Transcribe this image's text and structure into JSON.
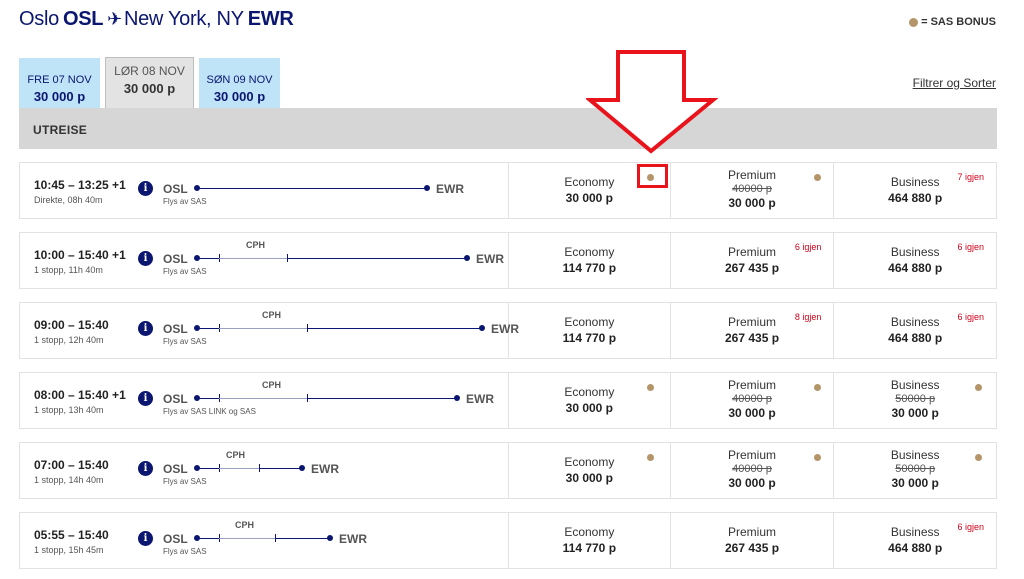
{
  "header": {
    "origin_city": "Oslo",
    "origin_code": "OSL",
    "plane_icon": "plane-icon",
    "dest_city": "New York, NY",
    "dest_code": "EWR",
    "bonus_legend": "= SAS BONUS",
    "bonus_color": "#b39569"
  },
  "tabs": [
    {
      "day": "FRE 07 NOV",
      "price": "30 000 p",
      "selected": false
    },
    {
      "day": "LØR 08 NOV",
      "price": "30 000 p",
      "selected": true
    },
    {
      "day": "SØN 09 NOV",
      "price": "30 000 p",
      "selected": false
    }
  ],
  "filter_link": "Filtrer og Sorter",
  "section_title": "UTREISE",
  "flights": [
    {
      "times": "10:45 – 13:25 +1",
      "stops": "Direkte, 08h 40m",
      "origin": "OSL",
      "dest": "EWR",
      "via": "",
      "operator": "Flys av SAS",
      "economy": {
        "label": "Economy",
        "old": "",
        "price": "30 000 p",
        "seats": "",
        "bonus": true
      },
      "premium": {
        "label": "Premium",
        "old": "40000 p",
        "price": "30 000 p",
        "seats": "",
        "bonus": true
      },
      "business": {
        "label": "Business",
        "old": "",
        "price": "464 880 p",
        "seats": "7 igjen",
        "bonus": false
      }
    },
    {
      "times": "10:00 – 15:40 +1",
      "stops": "1 stopp, 11h 40m",
      "origin": "OSL",
      "dest": "EWR",
      "via": "CPH",
      "operator": "Flys av SAS",
      "economy": {
        "label": "Economy",
        "old": "",
        "price": "114 770 p",
        "seats": "",
        "bonus": false
      },
      "premium": {
        "label": "Premium",
        "old": "",
        "price": "267 435 p",
        "seats": "6 igjen",
        "bonus": false
      },
      "business": {
        "label": "Business",
        "old": "",
        "price": "464 880 p",
        "seats": "6 igjen",
        "bonus": false
      }
    },
    {
      "times": "09:00 – 15:40",
      "stops": "1 stopp, 12h 40m",
      "origin": "OSL",
      "dest": "EWR",
      "via": "CPH",
      "operator": "Flys av SAS",
      "economy": {
        "label": "Economy",
        "old": "",
        "price": "114 770 p",
        "seats": "",
        "bonus": false
      },
      "premium": {
        "label": "Premium",
        "old": "",
        "price": "267 435 p",
        "seats": "8 igjen",
        "bonus": false
      },
      "business": {
        "label": "Business",
        "old": "",
        "price": "464 880 p",
        "seats": "6 igjen",
        "bonus": false
      }
    },
    {
      "times": "08:00 – 15:40 +1",
      "stops": "1 stopp, 13h 40m",
      "origin": "OSL",
      "dest": "EWR",
      "via": "CPH",
      "operator": "Flys av SAS LINK og SAS",
      "economy": {
        "label": "Economy",
        "old": "",
        "price": "30 000 p",
        "seats": "",
        "bonus": true
      },
      "premium": {
        "label": "Premium",
        "old": "40000 p",
        "price": "30 000 p",
        "seats": "",
        "bonus": true
      },
      "business": {
        "label": "Business",
        "old": "50000 p",
        "price": "30 000 p",
        "seats": "",
        "bonus": true
      }
    },
    {
      "times": "07:00 – 15:40",
      "stops": "1 stopp, 14h 40m",
      "origin": "OSL",
      "dest": "EWR",
      "via": "CPH",
      "operator": "Flys av SAS",
      "economy": {
        "label": "Economy",
        "old": "",
        "price": "30 000 p",
        "seats": "",
        "bonus": true
      },
      "premium": {
        "label": "Premium",
        "old": "40000 p",
        "price": "30 000 p",
        "seats": "",
        "bonus": true
      },
      "business": {
        "label": "Business",
        "old": "50000 p",
        "price": "30 000 p",
        "seats": "",
        "bonus": true
      }
    },
    {
      "times": "05:55 – 15:40",
      "stops": "1 stopp, 15h 45m",
      "origin": "OSL",
      "dest": "EWR",
      "via": "CPH",
      "operator": "Flys av SAS",
      "economy": {
        "label": "Economy",
        "old": "",
        "price": "114 770 p",
        "seats": "",
        "bonus": false
      },
      "premium": {
        "label": "Premium",
        "old": "",
        "price": "267 435 p",
        "seats": "",
        "bonus": false
      },
      "business": {
        "label": "Business",
        "old": "",
        "price": "464 880 p",
        "seats": "6 igjen",
        "bonus": false
      }
    }
  ]
}
